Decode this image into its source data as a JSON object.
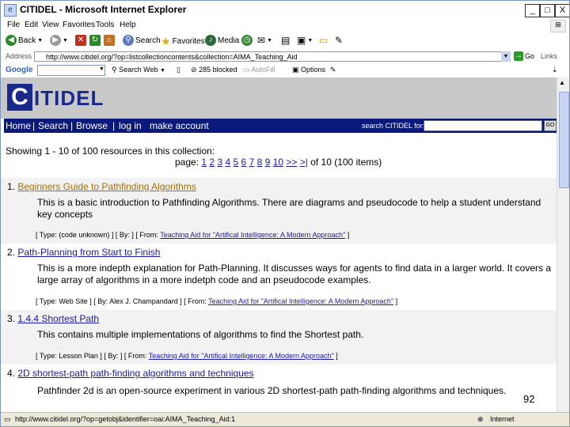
{
  "window": {
    "title": "CITIDEL - Microsoft Internet Explorer",
    "buttons": [
      "_",
      "□",
      "X"
    ]
  },
  "menu": [
    "File",
    "Edit",
    "View",
    "Favorites",
    "Tools",
    "Help"
  ],
  "toolbar": {
    "back": "Back",
    "search": "Search",
    "favorites": "Favorites",
    "media": "Media"
  },
  "address": {
    "label": "Address",
    "url": "http://www.citidel.org/?op=listcollectioncontents&collection=AIMA_Teaching_Aid",
    "go": "Go",
    "links": "Links"
  },
  "googlebar": {
    "label": "Google",
    "search_web": "Search Web",
    "blocked": "285 blocked",
    "autofill": "AutoFill",
    "options": "Options"
  },
  "site": {
    "logo_first": "C",
    "logo_rest": "ITIDEL",
    "nav": [
      "Home",
      "Search",
      "Browse",
      "log in",
      "make account"
    ],
    "search_label": "search CITIDEL for:",
    "go": "GO"
  },
  "results": {
    "showing": "Showing 1 - 10 of 100 resources in this collection:",
    "page_label": "page:",
    "pages": [
      "1",
      "2",
      "3",
      "4",
      "5",
      "6",
      "7",
      "8",
      "9",
      "10",
      ">>",
      ">|"
    ],
    "of_text": "of 10 (100 items)"
  },
  "items": [
    {
      "num": "1.",
      "title": "Beginners Guide to Pathfinding Algorithms",
      "desc": "This is a basic introduction to Pathfinding Algorithms. There are diagrams and pseudocode to help a student understand key concepts",
      "meta_pre": "[ Type: (code unknown) ] [ By: ] [ From: ",
      "meta_link": "Teaching Aid for \"Artifical Intelligence: A Modern Approach\"",
      "meta_post": " ]"
    },
    {
      "num": "2.",
      "title": "Path-Planning from Start to Finish",
      "desc": "This is a more indepth explanation for Path-Planning. It discusses ways for agents to find data in a larger world. It covers a large array of algorithms in a more indetph code and an pseudocode examples.",
      "meta_pre": "[ Type: Web Site ] [ By: Alex J. Champandard ] [ From: ",
      "meta_link": "Teaching Aid for \"Artifical Intelligence: A Modern Approach\"",
      "meta_post": " ]"
    },
    {
      "num": "3.",
      "title": "1.4.4 Shortest Path",
      "desc": "This contains multiple implementations of algorithms to find the Shortest path.",
      "meta_pre": "[ Type: Lesson Plan ] [ By: ] [ From: ",
      "meta_link": "Teaching Aid for \"Artifical Intelligence: A Modern Approach\"",
      "meta_post": " ]"
    },
    {
      "num": "4.",
      "title": "2D shortest-path path-finding algorithms and techniques",
      "desc": "Pathfinder 2d is an open-source experiment in various 2D shortest-path path-finding algorithms and techniques.",
      "meta_pre": "",
      "meta_link": "",
      "meta_post": ""
    }
  ],
  "slide_number": "92",
  "status": {
    "url": "http://www.citidel.org/?op=getobj&identifier=oai:AIMA_Teaching_Aid:1",
    "zone": "Internet"
  }
}
